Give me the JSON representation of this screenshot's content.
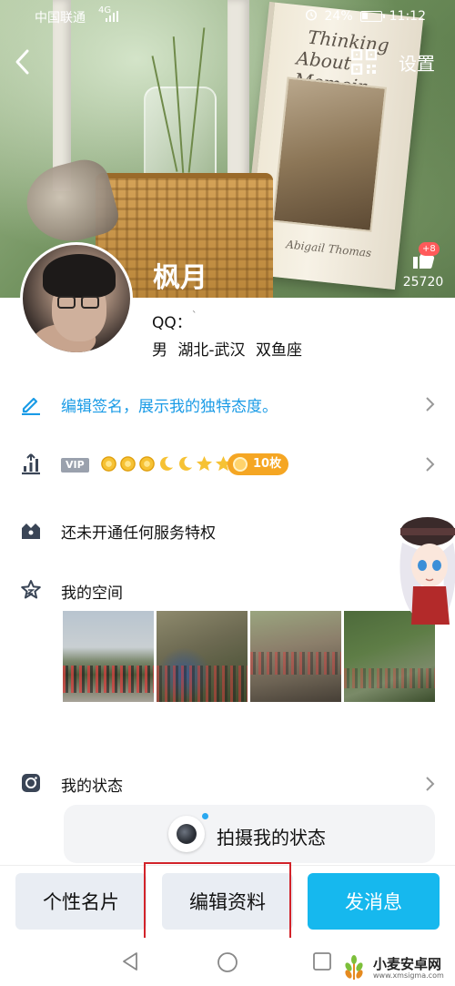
{
  "status_bar": {
    "carrier": "中国联通",
    "network": "4G",
    "battery": "24%",
    "time": "11:12"
  },
  "header": {
    "settings_label": "设置",
    "like_count": "25720",
    "like_badge": "+8",
    "book_title_line1": "Thinking",
    "book_title_line2": "About Memoir",
    "book_author": "Abigail Thomas"
  },
  "profile": {
    "nickname": "枫月",
    "qq_label": "QQ：",
    "qq_value": "`",
    "gender": "男",
    "location": "湖北-武汉",
    "zodiac": "双鱼座"
  },
  "rows": {
    "signature": "编辑签名，展示我的独特态度。",
    "vip_tag": "VIP",
    "coin_tag": "10枚",
    "privilege": "还未开通任何服务特权",
    "space": "我的空间",
    "status": "我的状态"
  },
  "capture": {
    "label": "拍摄我的状态"
  },
  "actions": {
    "card": "个性名片",
    "edit": "编辑资料",
    "message": "发消息"
  },
  "watermark": {
    "name": "小麦安卓网",
    "url": "www.xmsigma.com"
  },
  "colors": {
    "accent": "#16b8ee",
    "signature_text": "#1a9be6",
    "highlight": "#d2232a",
    "coin": "#f5a623"
  }
}
